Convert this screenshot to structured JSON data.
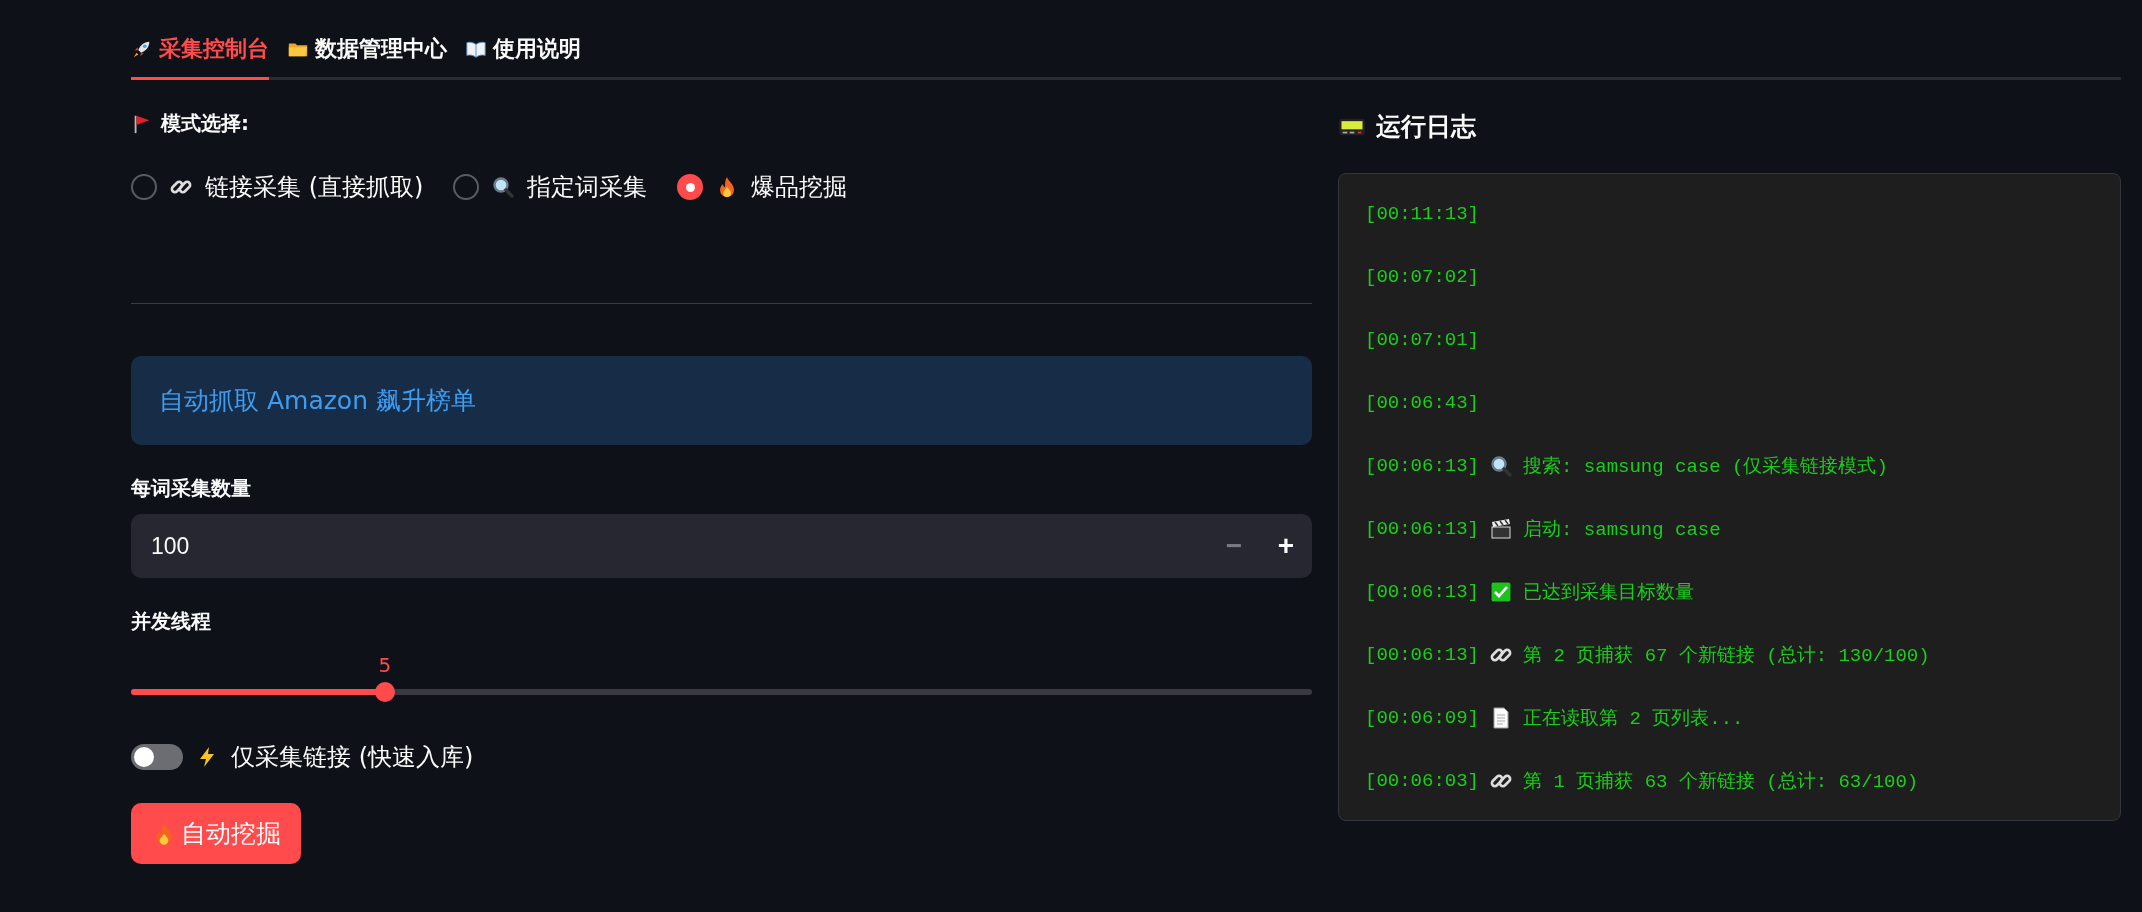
{
  "tabs": [
    {
      "kind": "rocket",
      "label": "采集控制台",
      "selected": true
    },
    {
      "kind": "folder",
      "label": "数据管理中心",
      "selected": false
    },
    {
      "kind": "book",
      "label": "使用说明",
      "selected": false
    }
  ],
  "mode": {
    "label": "模式选择:",
    "options": [
      {
        "kind": "link",
        "label": "链接采集 (直接抓取)",
        "selected": false
      },
      {
        "kind": "search",
        "label": "指定词采集",
        "selected": false
      },
      {
        "kind": "fire",
        "label": "爆品挖掘",
        "selected": true
      }
    ]
  },
  "info": "自动抓取 Amazon 飙升榜单",
  "count": {
    "label": "每词采集数量",
    "value": "100",
    "minus": "−",
    "plus": "+"
  },
  "threads": {
    "label": "并发线程",
    "reading": "5",
    "level": 0.215
  },
  "link_only": {
    "label": "仅采集链接 (快速入库)",
    "on": false
  },
  "start_button": "自动挖掘",
  "log": {
    "title": "运行日志",
    "rows": [
      {
        "kind": "none",
        "time": "[00:11:13]"
      },
      {
        "kind": "none",
        "time": "[00:07:02]"
      },
      {
        "kind": "none",
        "time": "[00:07:01]"
      },
      {
        "kind": "none",
        "time": "[00:06:43]"
      },
      {
        "kind": "search",
        "time": "[00:06:13]",
        "text": "搜索: samsung case (仅采集链接模式)"
      },
      {
        "kind": "clapper",
        "time": "[00:06:13]",
        "text": "启动: samsung case"
      },
      {
        "kind": "check",
        "time": "[00:06:13]",
        "text": "已达到采集目标数量"
      },
      {
        "kind": "link",
        "time": "[00:06:13]",
        "text": "第 2 页捕获 67 个新链接 (总计: 130/100)"
      },
      {
        "kind": "page",
        "time": "[00:06:09]",
        "text": "正在读取第 2 页列表..."
      },
      {
        "kind": "link",
        "time": "[00:06:03]",
        "text": "第 1 页捕获 63 个新链接 (总计: 63/100)"
      }
    ]
  }
}
